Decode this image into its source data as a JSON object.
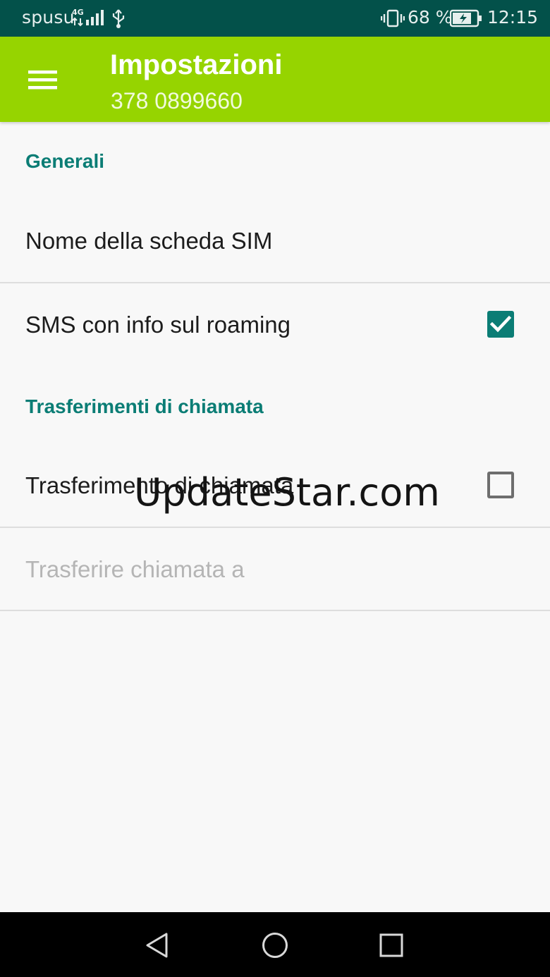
{
  "status_bar": {
    "carrier": "spusu",
    "network_type": "4G",
    "battery_percent": "68 %",
    "time": "12:15",
    "icons": [
      "signal-icon",
      "usb-icon",
      "vibrate-icon",
      "battery-charging-icon"
    ]
  },
  "app_bar": {
    "title": "Impostazioni",
    "subtitle": "378 0899660",
    "menu_icon": "menu-icon",
    "color": "#96d400"
  },
  "sections": {
    "general": {
      "header": "Generali",
      "items": {
        "sim_name": {
          "label": "Nome della scheda SIM"
        },
        "roaming_sms": {
          "label": "SMS con info sul roaming",
          "checked": true
        }
      }
    },
    "call_forwarding": {
      "header": "Trasferimenti di chiamata",
      "items": {
        "forwarding": {
          "label": "Trasferimento di chiamata",
          "checked": false
        },
        "forward_to": {
          "label": "Trasferire chiamata a",
          "enabled": false
        }
      }
    }
  },
  "watermark": "UpdateStar.com",
  "nav_bar": {
    "buttons": [
      "back-icon",
      "home-icon",
      "recents-icon"
    ]
  },
  "colors": {
    "status_bar": "#03514a",
    "accent": "#0b7d75",
    "disabled_text": "#b5b5b5"
  }
}
